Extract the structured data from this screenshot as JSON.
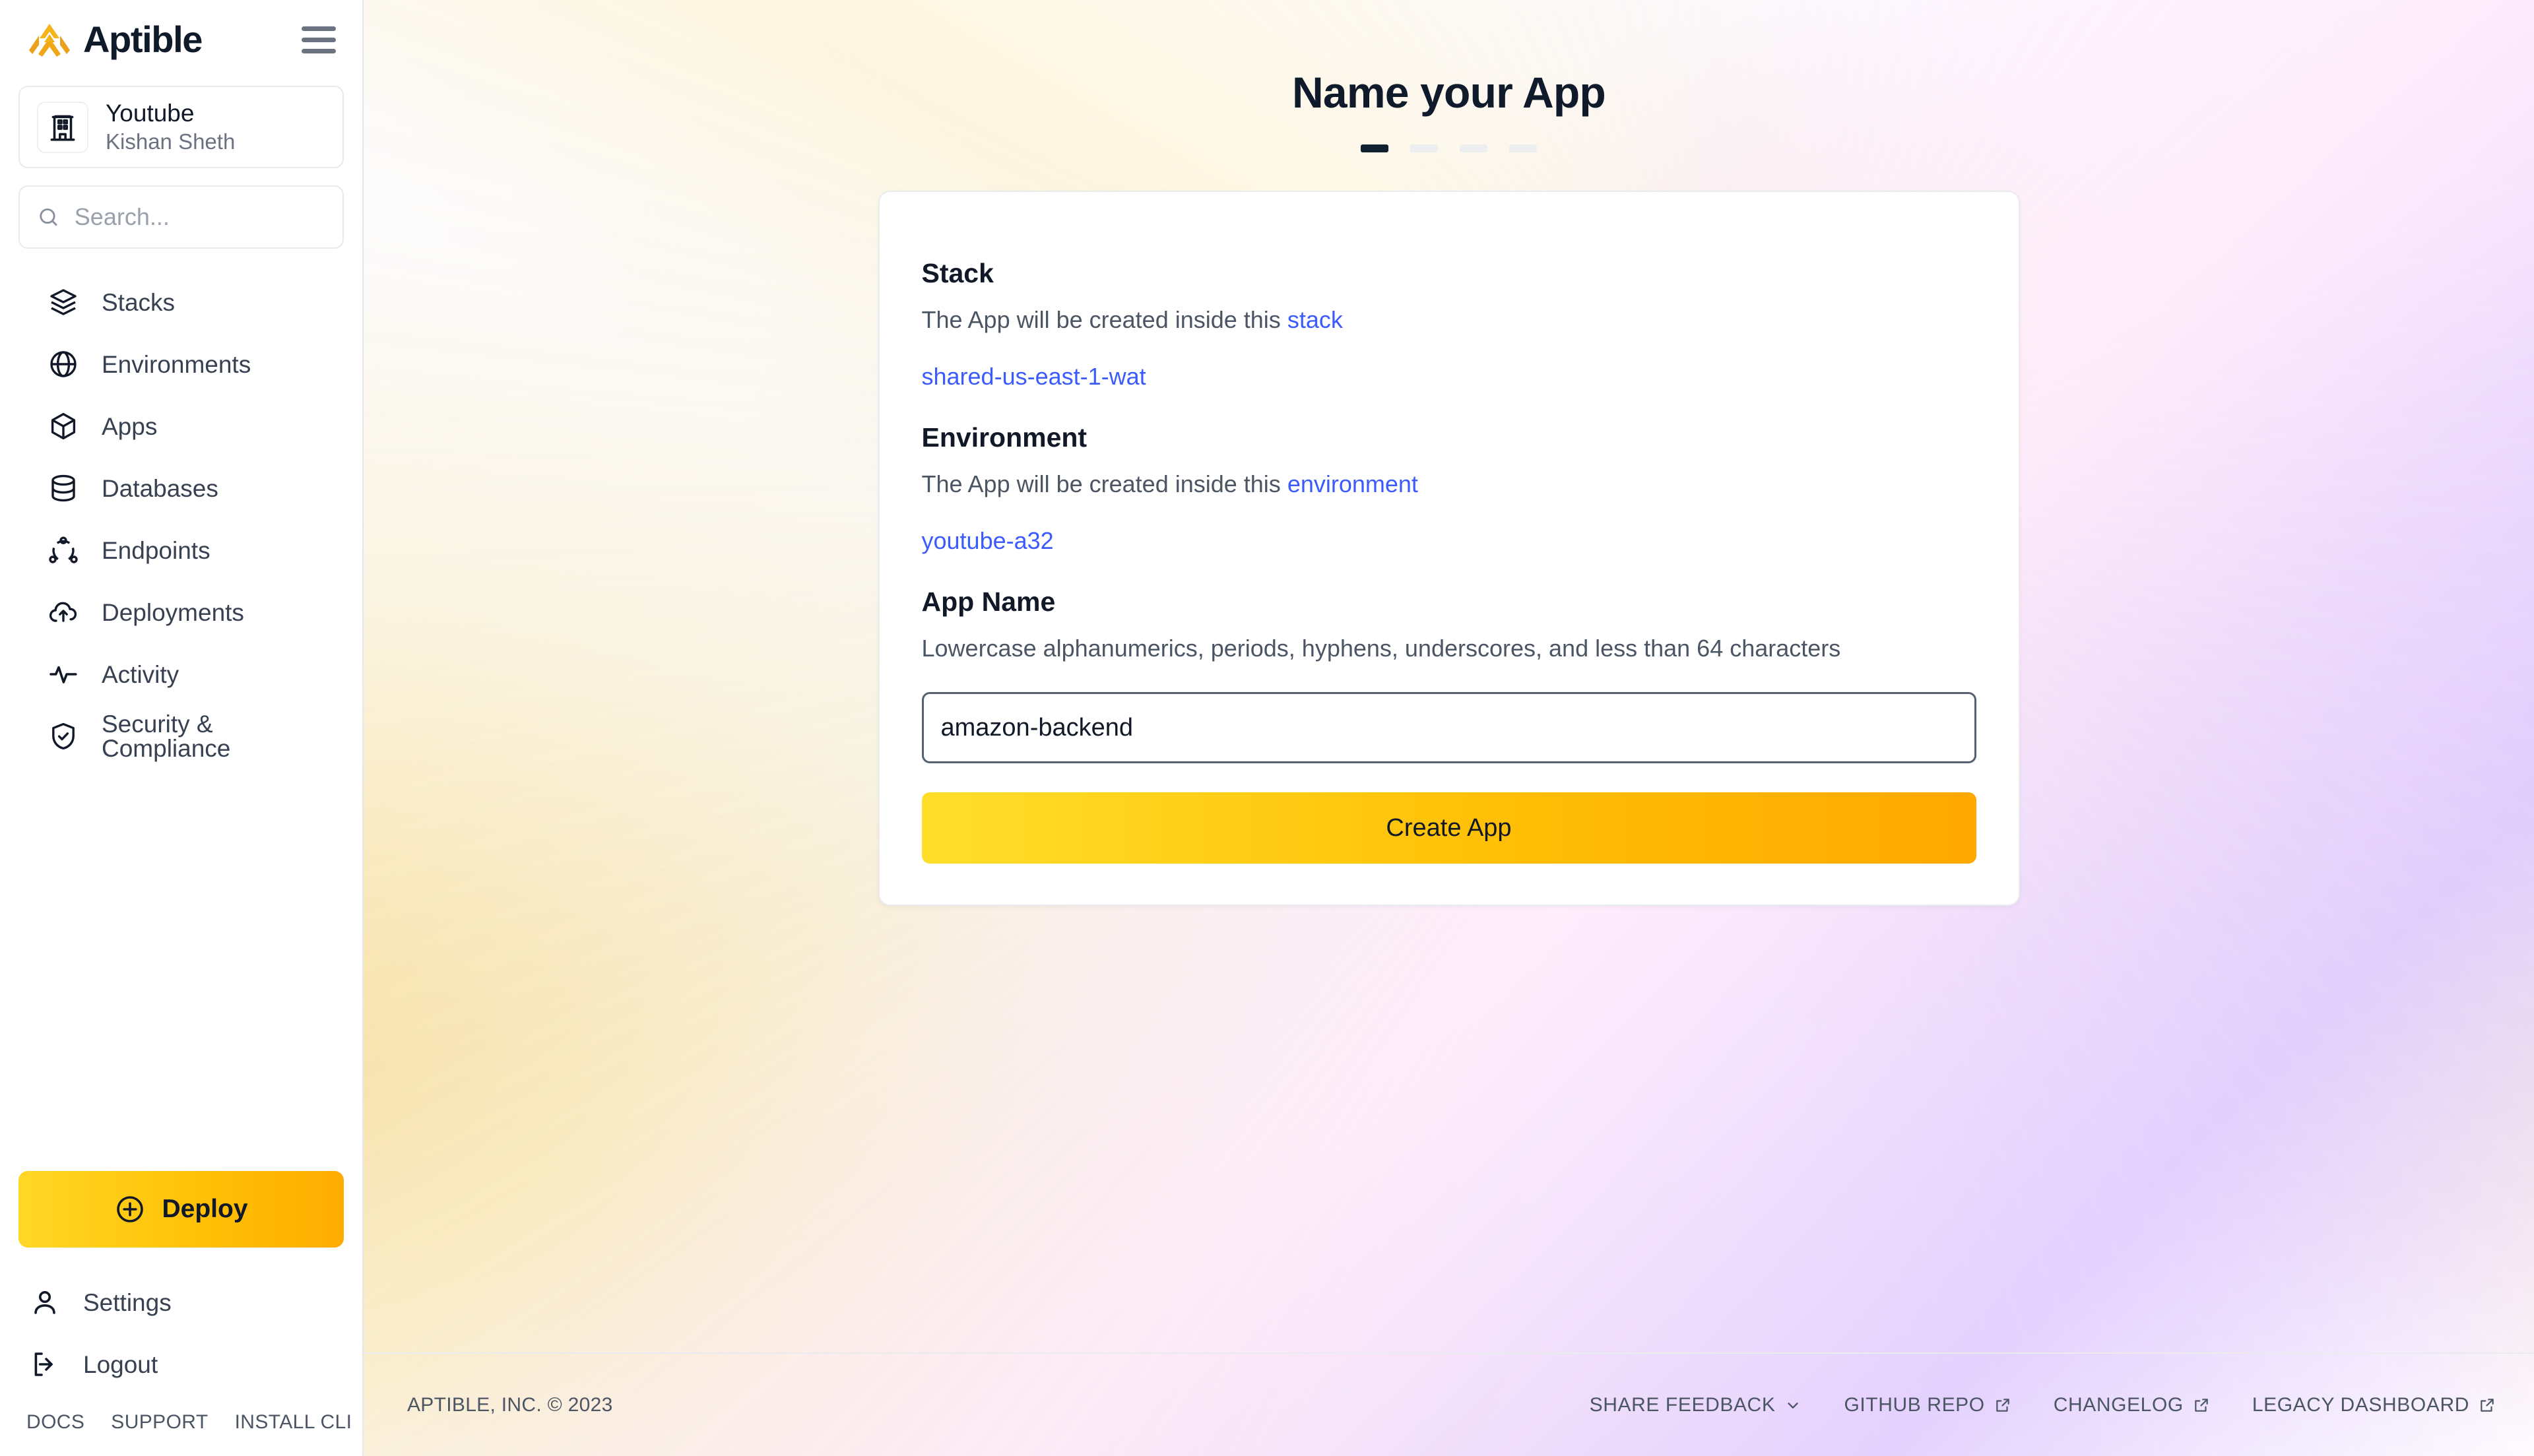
{
  "brand": {
    "word": "Aptible",
    "logo_icon": "aptible-chevron-logo",
    "menu_icon": "hamburger-icon"
  },
  "org": {
    "name": "Youtube",
    "user": "Kishan Sheth",
    "icon": "building-icon"
  },
  "search": {
    "placeholder": "Search...",
    "value": "",
    "icon": "search-icon"
  },
  "nav": {
    "items": [
      {
        "label": "Stacks",
        "icon": "layers-icon"
      },
      {
        "label": "Environments",
        "icon": "globe-icon"
      },
      {
        "label": "Apps",
        "icon": "cube-icon"
      },
      {
        "label": "Databases",
        "icon": "database-icon"
      },
      {
        "label": "Endpoints",
        "icon": "endpoints-icon"
      },
      {
        "label": "Deployments",
        "icon": "cloud-upload-icon"
      },
      {
        "label": "Activity",
        "icon": "activity-pulse-icon"
      },
      {
        "label": "Security & Compliance",
        "icon": "shield-check-icon"
      }
    ]
  },
  "sidebar_bottom": {
    "deploy_label": "Deploy",
    "deploy_icon": "plus-circle-icon",
    "settings_label": "Settings",
    "settings_icon": "user-icon",
    "logout_label": "Logout",
    "logout_icon": "logout-arrow-icon",
    "mini_links": [
      {
        "label": "DOCS"
      },
      {
        "label": "SUPPORT"
      },
      {
        "label": "INSTALL CLI"
      }
    ]
  },
  "main": {
    "title": "Name your App",
    "steps": {
      "total": 4,
      "active_index": 0
    },
    "card": {
      "stack": {
        "heading": "Stack",
        "desc_prefix": "The App will be created inside this ",
        "desc_link": "stack",
        "value": "shared-us-east-1-wat"
      },
      "environment": {
        "heading": "Environment",
        "desc_prefix": "The App will be created inside this ",
        "desc_link": "environment",
        "value": "youtube-a32"
      },
      "app_name": {
        "heading": "App Name",
        "desc": "Lowercase alphanumerics, periods, hyphens, underscores, and less than 64 characters",
        "value": "amazon-backend",
        "placeholder": ""
      },
      "submit_label": "Create App"
    }
  },
  "footer": {
    "copyright": "APTIBLE, INC. © 2023",
    "links": [
      {
        "label": "SHARE FEEDBACK",
        "icon": "chevron-down-icon"
      },
      {
        "label": "GITHUB REPO",
        "icon": "external-link-icon"
      },
      {
        "label": "CHANGELOG",
        "icon": "external-link-icon"
      },
      {
        "label": "LEGACY DASHBOARD",
        "icon": "external-link-icon"
      }
    ]
  },
  "colors": {
    "accent_yellow": "#FFC107",
    "link_blue": "#3B5BFD",
    "ink": "#0F1A2A",
    "muted": "#6B7280"
  }
}
